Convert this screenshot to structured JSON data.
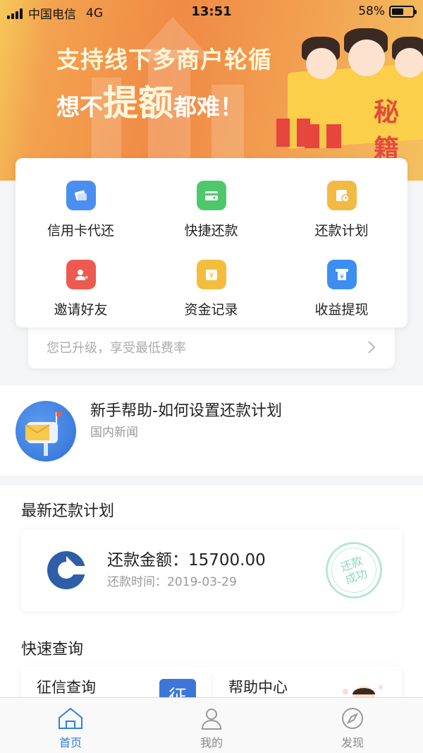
{
  "status_bar": {
    "carrier": "中国电信",
    "network": "4G",
    "time": "13:51",
    "battery": "58%",
    "battery_level": 0.58
  },
  "banner": {
    "line1": "支持线下多商户轮循",
    "line2_pre": "想不",
    "line2_big": "提额",
    "line2_post": "都难！",
    "book_text": "秘籍"
  },
  "actions": [
    {
      "label": "信用卡代还",
      "icon": "credit-card-repay-icon",
      "color": "#4a8ff0"
    },
    {
      "label": "快捷还款",
      "icon": "wallet-icon",
      "color": "#4fc86b"
    },
    {
      "label": "还款计划",
      "icon": "plan-clock-icon",
      "color": "#f2b943"
    },
    {
      "label": "邀请好友",
      "icon": "invite-user-icon",
      "color": "#ee5a50"
    },
    {
      "label": "资金记录",
      "icon": "money-record-icon",
      "color": "#f5bd3c"
    },
    {
      "label": "收益提现",
      "icon": "withdraw-icon",
      "color": "#3c8ff0"
    }
  ],
  "upgrade": {
    "text": "您已升级，享受最低费率"
  },
  "news": {
    "title": "新手帮助-如何设置还款计划",
    "source": "国内新闻"
  },
  "latest_plan": {
    "section_title": "最新还款计划",
    "amount_label": "还款金额：",
    "amount": "15700.00",
    "time_label": "还款时间：",
    "time": "2019-03-29",
    "stamp_line1": "还款",
    "stamp_line2": "成功"
  },
  "quick_query": {
    "section_title": "快速查询",
    "items": [
      {
        "label": "征信查询",
        "badge": "征"
      },
      {
        "label": "帮助中心"
      }
    ]
  },
  "tabbar": [
    {
      "label": "首页",
      "icon": "home-icon",
      "active": true
    },
    {
      "label": "我的",
      "icon": "user-icon",
      "active": false
    },
    {
      "label": "发现",
      "icon": "compass-icon",
      "active": false
    }
  ],
  "colors": {
    "accent": "#2f7de1",
    "banner_orange": "#f08a45"
  }
}
